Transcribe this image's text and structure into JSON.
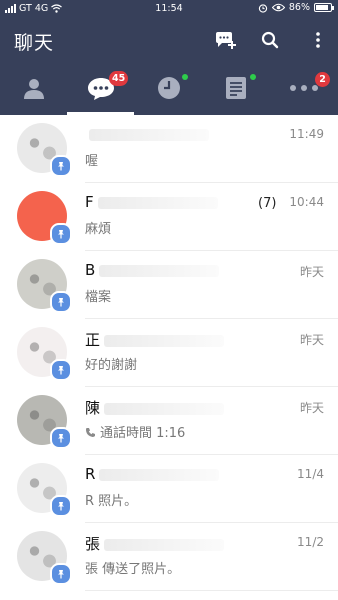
{
  "status_bar": {
    "carrier": "GT 4G",
    "time": "11:54",
    "battery": "86%",
    "battery_level": 0.86
  },
  "header": {
    "title": "聊天"
  },
  "tabs": [
    {
      "icon": "person-icon",
      "badge": ""
    },
    {
      "icon": "chat-bubble-icon",
      "badge": "45"
    },
    {
      "icon": "clock-icon",
      "badge": ""
    },
    {
      "icon": "note-icon",
      "badge": ""
    },
    {
      "icon": "more-icon",
      "badge": "2"
    }
  ],
  "chats": [
    {
      "name": "",
      "count": "",
      "preview": "喔",
      "time": "11:49",
      "avatar_color": "#e9e9e9"
    },
    {
      "name": "F",
      "count": "(7)",
      "preview": "麻煩",
      "time": "10:44",
      "avatar_color": "#f4634d"
    },
    {
      "name": "B",
      "count": "",
      "preview": "檔案",
      "time": "昨天",
      "avatar_color": "#cfcfc9"
    },
    {
      "name": "正",
      "count": "",
      "preview": "好的謝謝",
      "time": "昨天",
      "avatar_color": "#f3efef"
    },
    {
      "name": "陳",
      "count": "",
      "preview": "通話時間 1:16",
      "time": "昨天",
      "avatar_color": "#b8b8b3"
    },
    {
      "name": "R",
      "count": "",
      "preview": "R 照片。",
      "time": "11/4",
      "avatar_color": "#ededed"
    },
    {
      "name": "張",
      "count": "",
      "preview": "張 傳送了照片。",
      "time": "11/2",
      "avatar_color": "#e4e4e4"
    }
  ]
}
